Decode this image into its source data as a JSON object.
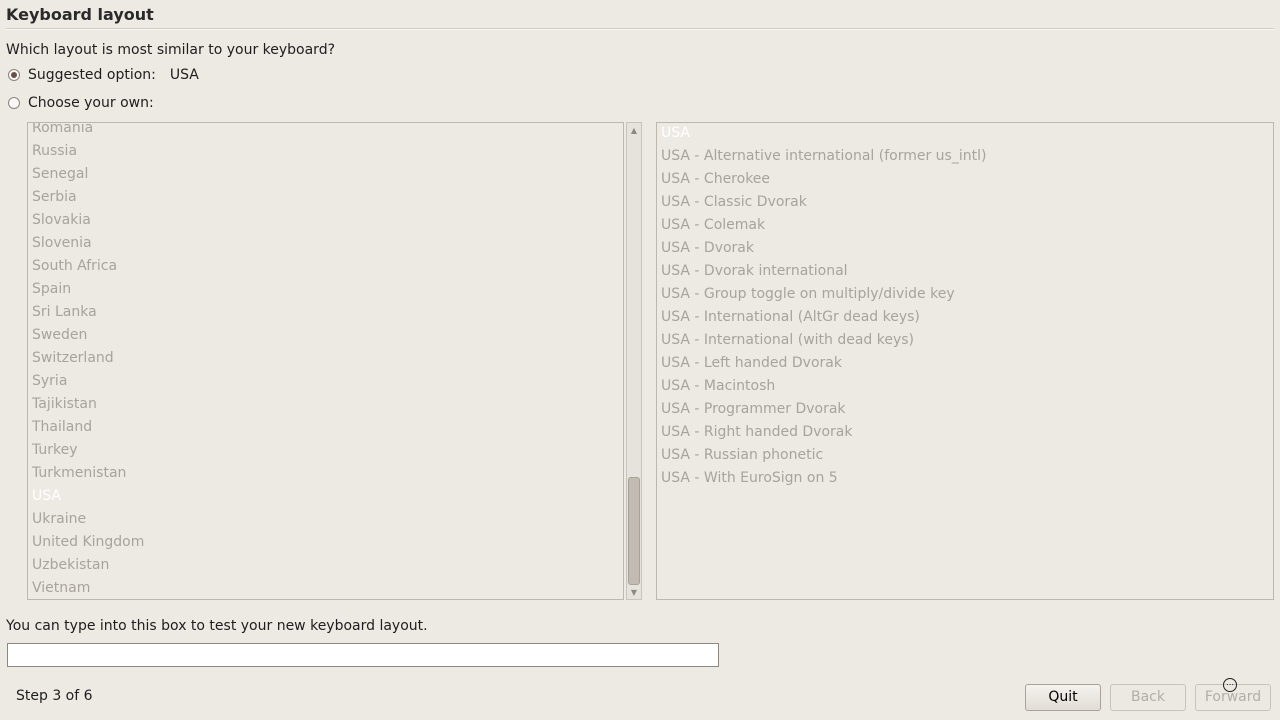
{
  "page": {
    "title": "Keyboard layout",
    "question": "Which layout is most similar to your keyboard?",
    "suggested_label": "Suggested option:",
    "suggested_value": "USA",
    "choose_label": "Choose your own:",
    "test_label": "You can type into this box to test your new keyboard layout.",
    "test_value": "",
    "step": "Step 3 of 6"
  },
  "countries": [
    {
      "label": "Romania"
    },
    {
      "label": "Russia"
    },
    {
      "label": "Senegal"
    },
    {
      "label": "Serbia"
    },
    {
      "label": "Slovakia"
    },
    {
      "label": "Slovenia"
    },
    {
      "label": "South Africa"
    },
    {
      "label": "Spain"
    },
    {
      "label": "Sri Lanka"
    },
    {
      "label": "Sweden"
    },
    {
      "label": "Switzerland"
    },
    {
      "label": "Syria"
    },
    {
      "label": "Tajikistan"
    },
    {
      "label": "Thailand"
    },
    {
      "label": "Turkey"
    },
    {
      "label": "Turkmenistan"
    },
    {
      "label": "USA",
      "selected": true
    },
    {
      "label": "Ukraine"
    },
    {
      "label": "United Kingdom"
    },
    {
      "label": "Uzbekistan"
    },
    {
      "label": "Vietnam"
    }
  ],
  "variants": [
    {
      "label": "USA",
      "selected": true
    },
    {
      "label": "USA - Alternative international (former us_intl)"
    },
    {
      "label": "USA - Cherokee"
    },
    {
      "label": "USA - Classic Dvorak"
    },
    {
      "label": "USA - Colemak"
    },
    {
      "label": "USA - Dvorak"
    },
    {
      "label": "USA - Dvorak international"
    },
    {
      "label": "USA - Group toggle on multiply/divide key"
    },
    {
      "label": "USA - International (AltGr dead keys)"
    },
    {
      "label": "USA - International (with dead keys)"
    },
    {
      "label": "USA - Left handed Dvorak"
    },
    {
      "label": "USA - Macintosh"
    },
    {
      "label": "USA - Programmer Dvorak"
    },
    {
      "label": "USA - Right handed Dvorak"
    },
    {
      "label": "USA - Russian phonetic"
    },
    {
      "label": "USA - With EuroSign on 5"
    }
  ],
  "buttons": {
    "quit": "Quit",
    "back": "Back",
    "forward": "Forward"
  },
  "icons": {
    "scroll_up": "chevron-up-icon",
    "scroll_down": "chevron-down-icon",
    "cursor": "busy-cursor-icon"
  },
  "colors": {
    "background": "#ede9e3",
    "list_text": "#a8a39c",
    "selected_text": "#ffffff",
    "radio_dot": "#6b5145"
  }
}
